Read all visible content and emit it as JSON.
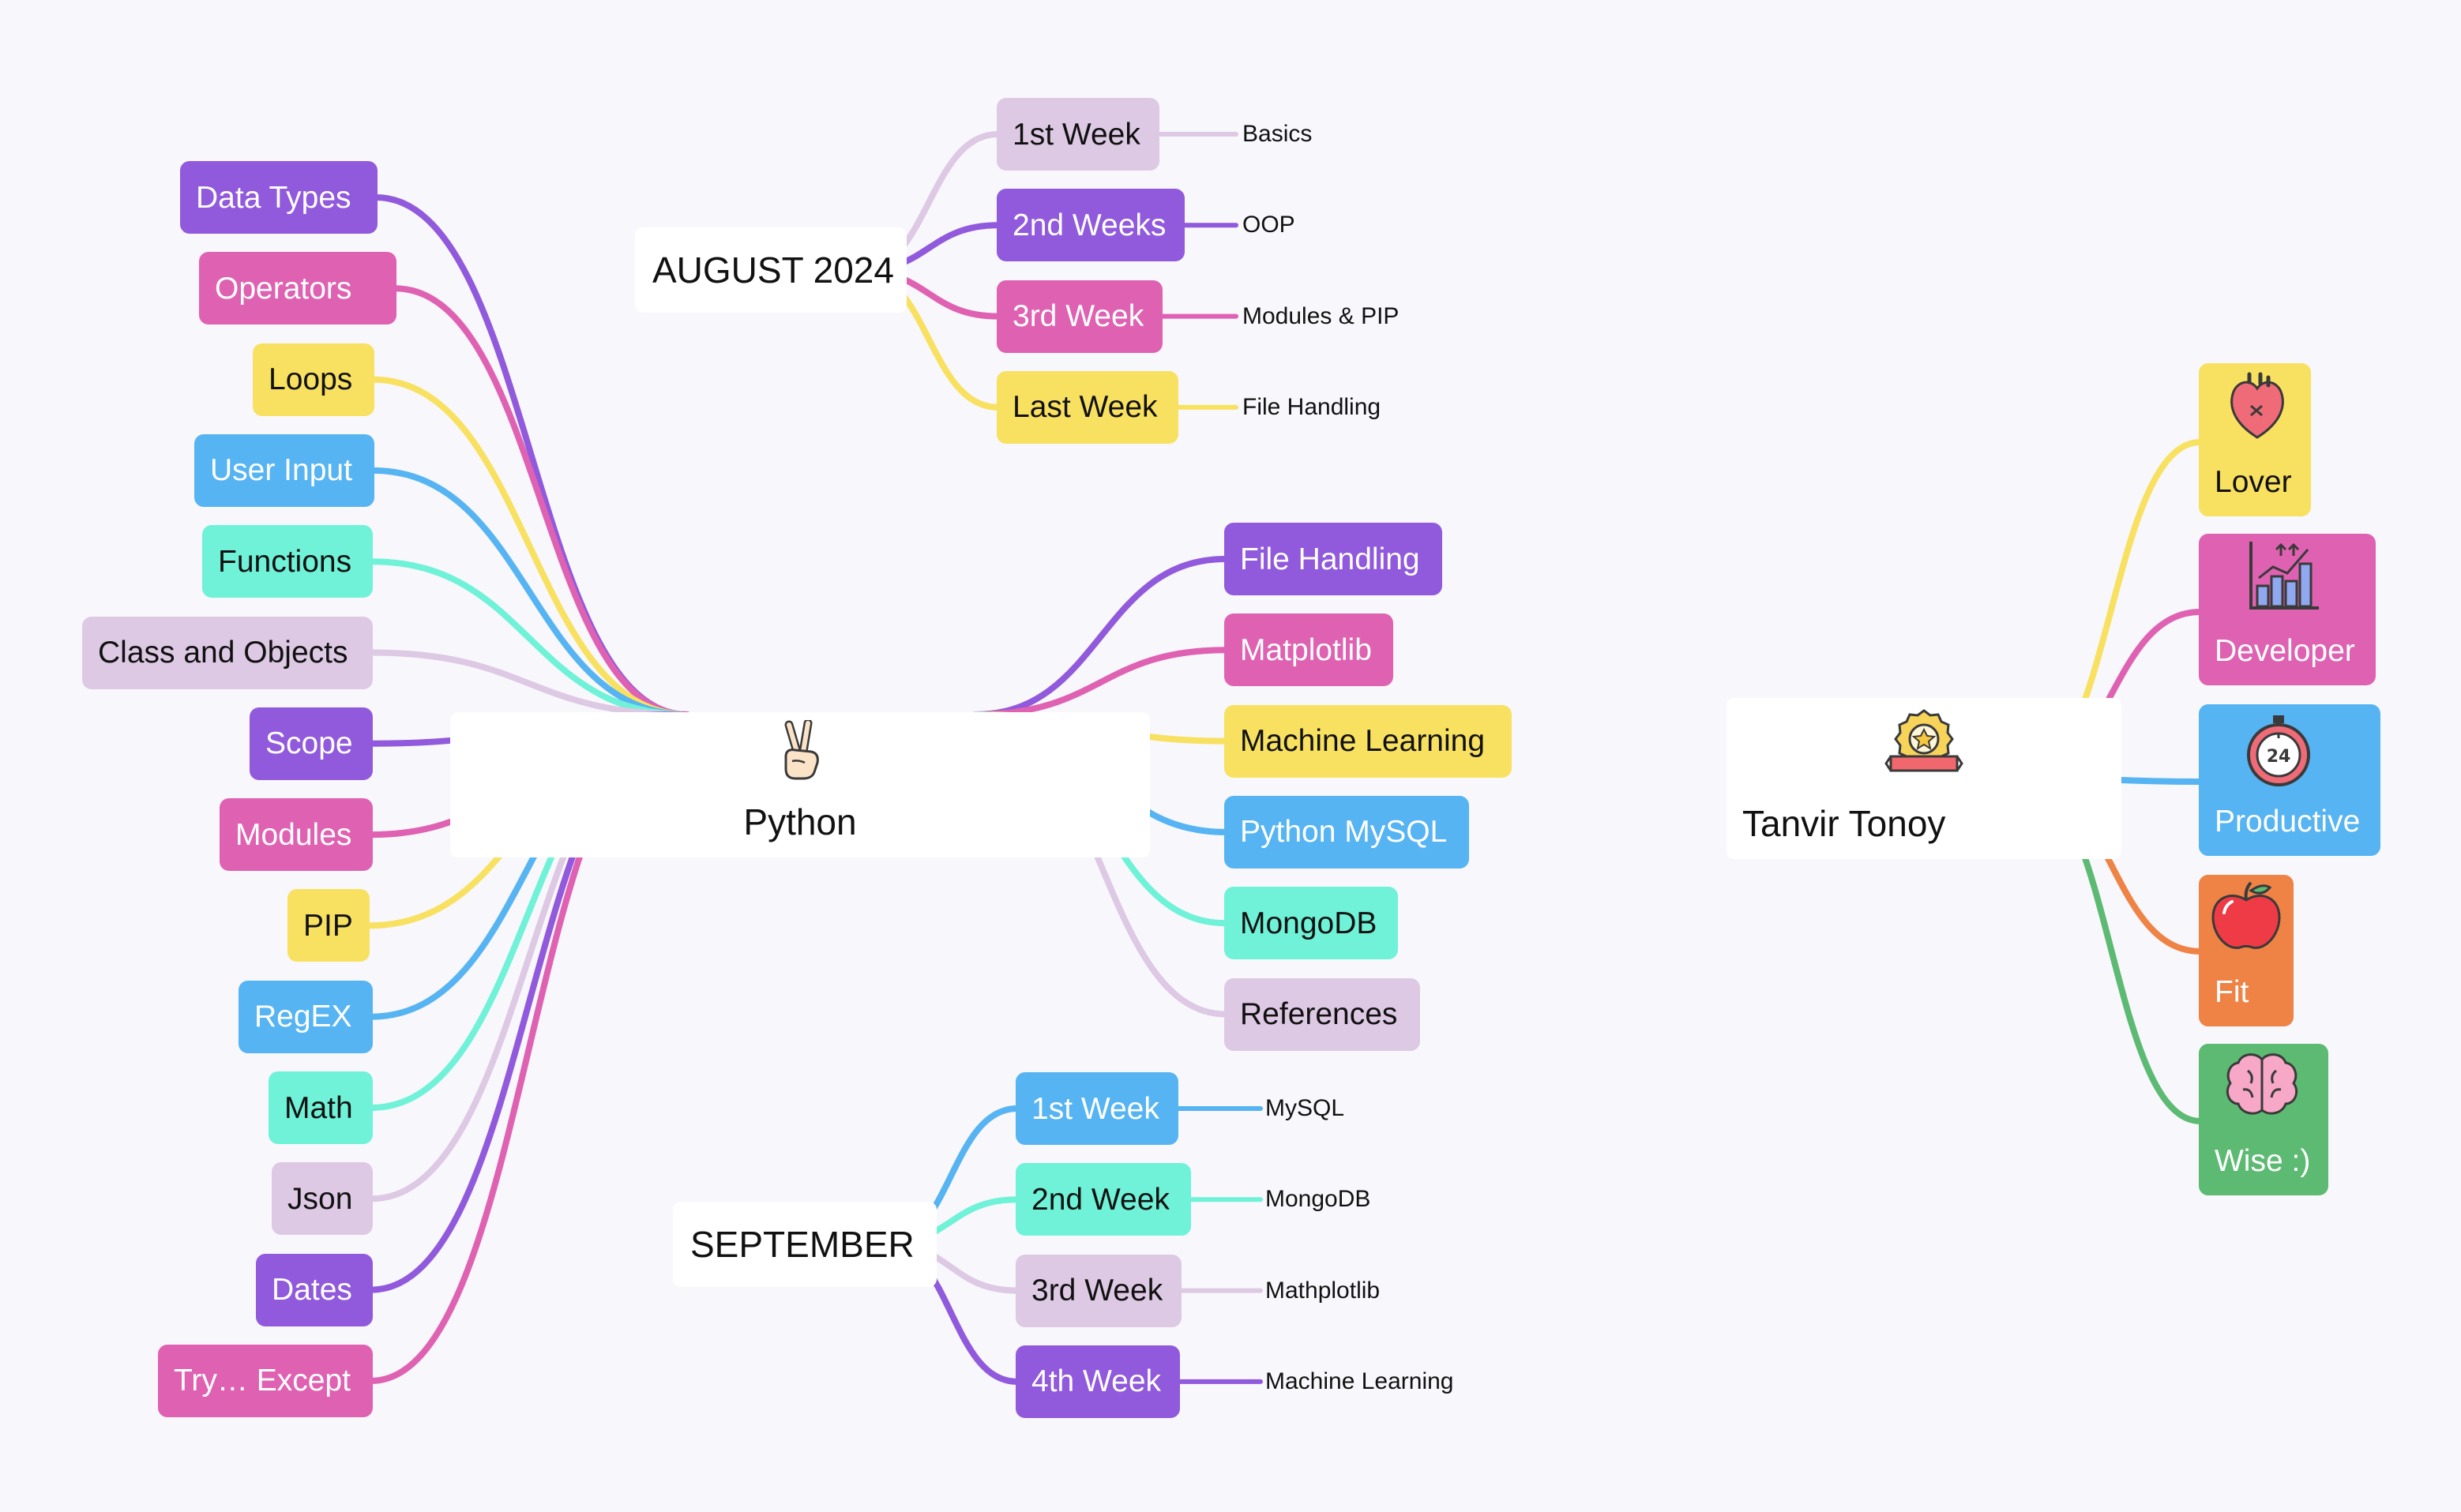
{
  "colors": {
    "background": "#f8f7fc",
    "purple": "#9159dc",
    "pink": "#df62b2",
    "yellow": "#f8e160",
    "blue": "#56b4f2",
    "mint": "#6ff2d7",
    "lavender": "#ddc9e4",
    "orange": "#ef8245",
    "green": "#5dba72"
  },
  "python": {
    "title": "Python",
    "icon": "victory-hand-icon",
    "left": [
      {
        "label": "Data Types",
        "color": "purple"
      },
      {
        "label": "Operators",
        "color": "pink"
      },
      {
        "label": "Loops",
        "color": "yellow"
      },
      {
        "label": "User Input",
        "color": "blue"
      },
      {
        "label": "Functions",
        "color": "mint"
      },
      {
        "label": "Class and Objects",
        "color": "lavender"
      },
      {
        "label": "Scope",
        "color": "purple"
      },
      {
        "label": "Modules",
        "color": "pink"
      },
      {
        "label": "PIP",
        "color": "yellow"
      },
      {
        "label": "RegEX",
        "color": "blue"
      },
      {
        "label": "Math",
        "color": "mint"
      },
      {
        "label": "Json",
        "color": "lavender"
      },
      {
        "label": "Dates",
        "color": "purple"
      },
      {
        "label": "Try… Except",
        "color": "pink"
      }
    ],
    "right": [
      {
        "label": "File Handling",
        "color": "purple"
      },
      {
        "label": "Matplotlib",
        "color": "pink"
      },
      {
        "label": "Machine Learning",
        "color": "yellow"
      },
      {
        "label": "Python MySQL",
        "color": "blue"
      },
      {
        "label": "MongoDB",
        "color": "mint"
      },
      {
        "label": "References",
        "color": "lavender"
      }
    ]
  },
  "august": {
    "title": "AUGUST 2024",
    "weeks": [
      {
        "label": "1st Week",
        "leaf": "Basics",
        "color": "lavender"
      },
      {
        "label": "2nd Weeks",
        "leaf": "OOP",
        "color": "purple"
      },
      {
        "label": "3rd Week",
        "leaf": "Modules & PIP",
        "color": "pink"
      },
      {
        "label": "Last Week",
        "leaf": "File Handling",
        "color": "yellow"
      }
    ]
  },
  "september": {
    "title": "SEPTEMBER",
    "weeks": [
      {
        "label": "1st Week",
        "leaf": "MySQL",
        "color": "blue"
      },
      {
        "label": "2nd Week",
        "leaf": "MongoDB",
        "color": "mint"
      },
      {
        "label": "3rd Week",
        "leaf": "Mathplotlib",
        "color": "lavender"
      },
      {
        "label": "4th Week",
        "leaf": "Machine Learning",
        "color": "purple"
      }
    ]
  },
  "tanvir": {
    "title": "Tanvir Tonoy",
    "icon": "award-badge-icon",
    "traits": [
      {
        "label": "Lover",
        "icon": "heart-icon",
        "color": "yellow"
      },
      {
        "label": "Developer",
        "icon": "growth-chart-icon",
        "color": "pink"
      },
      {
        "label": "Productive",
        "icon": "stopwatch-24-icon",
        "color": "blue"
      },
      {
        "label": "Fit",
        "icon": "apple-icon",
        "color": "orange"
      },
      {
        "label": "Wise :)",
        "icon": "brain-icon",
        "color": "green"
      }
    ]
  }
}
